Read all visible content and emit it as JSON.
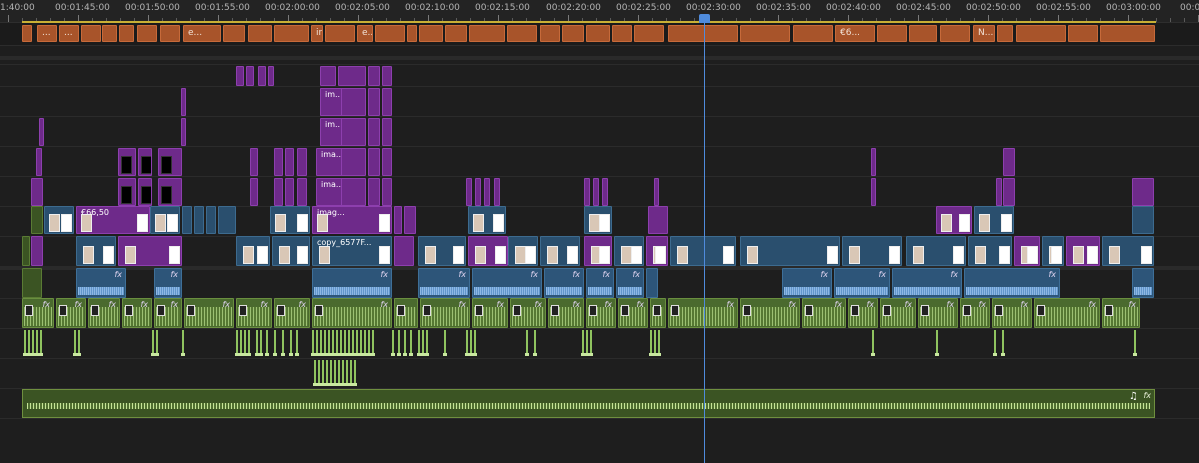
{
  "ruler": {
    "labels": [
      "1:40:00",
      "00:01:45:00",
      "00:01:50:00",
      "00:01:55:00",
      "00:02:00:00",
      "00:02:05:00",
      "00:02:10:00",
      "00:02:15:00",
      "00:02:20:00",
      "00:02:25:00",
      "00:02:30:00",
      "00:02:35:00",
      "00:02:40:00",
      "00:02:45:00",
      "00:02:50:00",
      "00:02:55:00",
      "00:03:00:00",
      "00:03"
    ]
  },
  "playhead": {
    "timecode_index": 10
  },
  "markers": {
    "clips": [
      {
        "label": "..."
      },
      {
        "label": "..."
      },
      {
        "label": "..."
      },
      {
        "label": "..."
      },
      {
        "label": "e..."
      },
      {
        "label": "..."
      },
      {
        "label": "inm..."
      },
      {
        "label": "e..."
      },
      {
        "label": "..."
      },
      {
        "label": "..."
      },
      {
        "label": "..."
      },
      {
        "label": "€6..."
      },
      {
        "label": "N..."
      },
      {
        "label": "..."
      }
    ]
  },
  "video": {
    "labels": {
      "euro_clip": "€66,50",
      "copy_clip": "copy_6577F...",
      "image_a": "imag...",
      "image_b": "ima...",
      "image_c": "ima...",
      "image_d": "im...",
      "image_e": "im...",
      "fx": "fx"
    }
  },
  "audio": {
    "fx": "fx"
  },
  "music": {
    "icon": "music-note-icon",
    "glyph": "♫",
    "fx": "fx"
  },
  "colors": {
    "orange": "#a8542a",
    "purple": "#6e2a8a",
    "teal": "#2a4f6e",
    "green": "#4a6a2e",
    "playhead": "#4f8bdc"
  }
}
